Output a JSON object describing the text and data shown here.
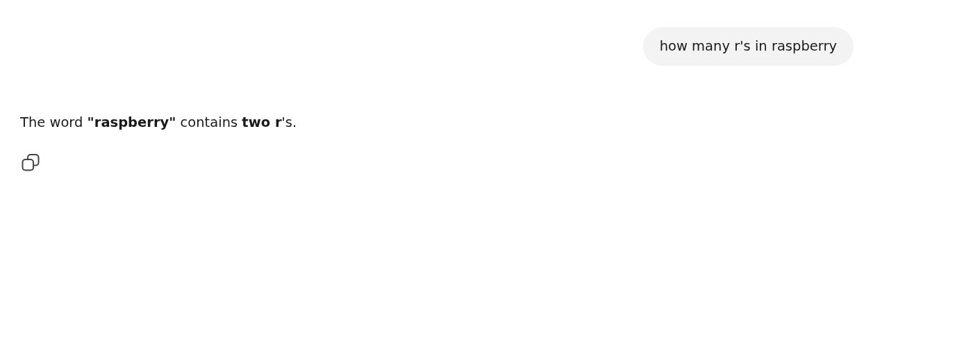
{
  "messages": [
    {
      "kind": "user",
      "text": "how many r's in raspberry"
    },
    {
      "kind": "assistant",
      "text": "The word **\"raspberry\"** contains **two r**'s.",
      "actions": [
        {
          "kind": "copy"
        }
      ]
    }
  ]
}
